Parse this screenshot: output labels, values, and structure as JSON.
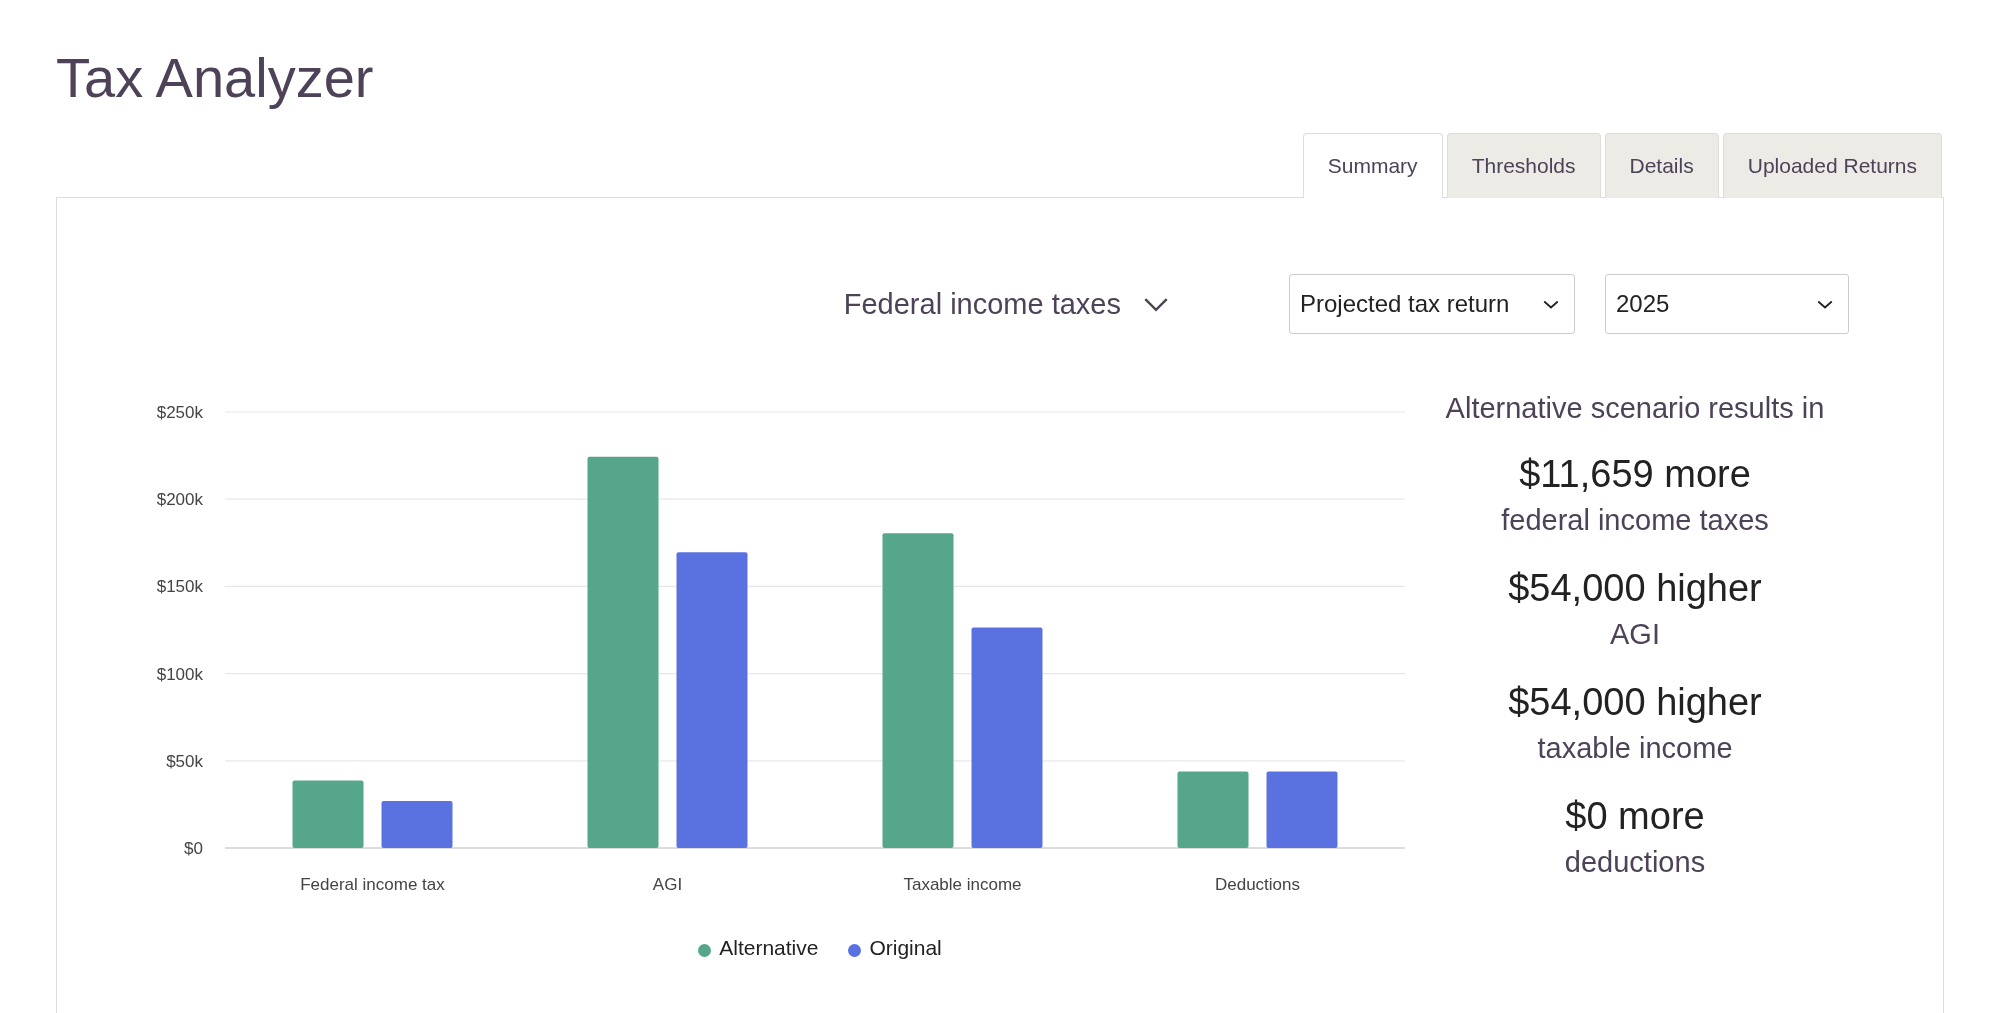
{
  "app_title": "Tax Analyzer",
  "tabs": [
    {
      "label": "Summary",
      "selected": true
    },
    {
      "label": "Thresholds",
      "selected": false
    },
    {
      "label": "Details",
      "selected": false
    },
    {
      "label": "Uploaded Returns",
      "selected": false
    }
  ],
  "controls": {
    "tax_type": "Federal income taxes",
    "return_type": "Projected tax return",
    "year": "2025"
  },
  "chart_data": {
    "type": "bar",
    "grid": true,
    "categories": [
      "Federal income tax",
      "AGI",
      "Taxable income",
      "Deductions"
    ],
    "series": [
      {
        "name": "Alternative",
        "color": "#55a68a",
        "values": [
          38700,
          224300,
          180500,
          43900
        ]
      },
      {
        "name": "Original",
        "color": "#5a72e0",
        "values": [
          27000,
          169600,
          126500,
          43900
        ]
      }
    ],
    "ylim": [
      0,
      250000
    ],
    "yticks": [
      {
        "value": 0,
        "label": "$0"
      },
      {
        "value": 50000,
        "label": "$50k"
      },
      {
        "value": 100000,
        "label": "$100k"
      },
      {
        "value": 150000,
        "label": "$150k"
      },
      {
        "value": 200000,
        "label": "$200k"
      },
      {
        "value": 250000,
        "label": "$250k"
      }
    ]
  },
  "summary": {
    "heading": "Alternative scenario results in",
    "items": [
      {
        "value": "$11,659 more",
        "label": "federal income taxes"
      },
      {
        "value": "$54,000 higher",
        "label": "AGI"
      },
      {
        "value": "$54,000 higher",
        "label": "taxable income"
      },
      {
        "value": "$0 more",
        "label": "deductions"
      }
    ]
  }
}
